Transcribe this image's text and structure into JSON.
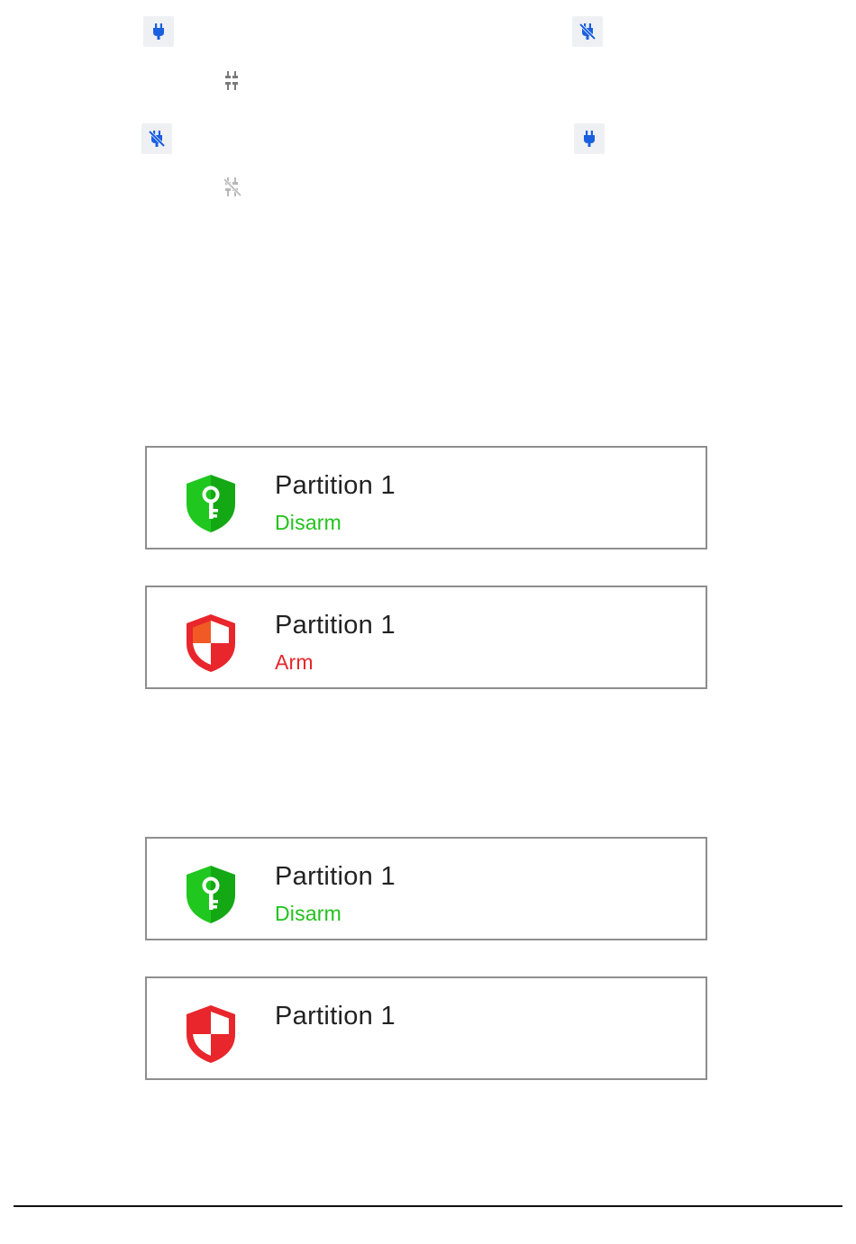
{
  "icons": {
    "plug_connected": "power-plug-icon",
    "plug_disconnected": "power-plug-off-icon",
    "connection_ok": "connection-icon",
    "connection_lost": "connection-off-icon"
  },
  "colors": {
    "icon_blue": "#1a5fe0",
    "icon_gray": "#7a7a7a",
    "icon_gray_light": "#b8b8b8",
    "disarm_green": "#22c21a",
    "arm_red": "#e8262b",
    "card_border": "#8e8e8e"
  },
  "cards": [
    {
      "title": "Partition 1",
      "status": "Disarm",
      "state": "disarmed"
    },
    {
      "title": "Partition 1",
      "status": "Arm",
      "state": "armed"
    },
    {
      "title": "Partition 1",
      "status": "Disarm",
      "state": "disarmed"
    },
    {
      "title": "Partition 1",
      "status": "",
      "state": "armed"
    }
  ]
}
